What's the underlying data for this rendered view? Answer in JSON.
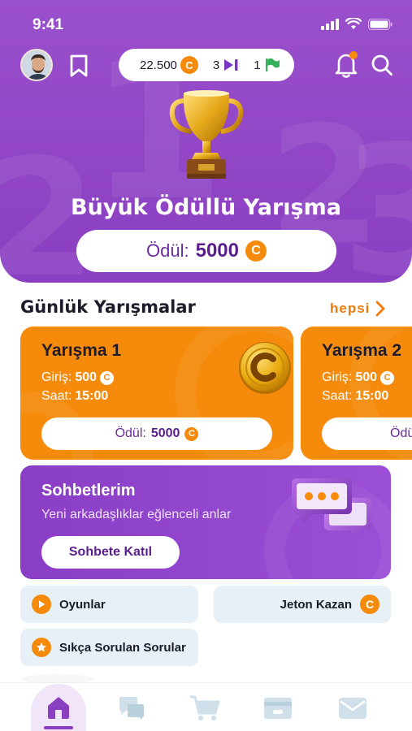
{
  "status_bar": {
    "time": "9:41"
  },
  "top_bar": {
    "coins": "22.500",
    "coin_symbol": "C",
    "tickets": "3",
    "flags": "1"
  },
  "hero": {
    "title": "Büyük Ödüllü Yarışma",
    "prize_label": "Ödül:",
    "prize_value": "5000",
    "coin_symbol": "C"
  },
  "daily": {
    "section_title": "Günlük Yarışmalar",
    "see_all": "hepsi",
    "cards": [
      {
        "title": "Yarışma 1",
        "entry_label": "Giriş:",
        "entry_value": "500",
        "time_label": "Saat:",
        "time_value": "15:00",
        "prize_label": "Ödül:",
        "prize_value": "5000",
        "coin_symbol": "C"
      },
      {
        "title": "Yarışma 2",
        "entry_label": "Giriş:",
        "entry_value": "500",
        "time_label": "Saat:",
        "time_value": "15:00",
        "prize_label": "Ödü",
        "prize_value": "",
        "coin_symbol": "C"
      }
    ]
  },
  "chat": {
    "title": "Sohbetlerim",
    "subtitle": "Yeni arkadaşlıklar eğlenceli anlar",
    "button": "Sohbete Katıl"
  },
  "tiles": {
    "games": "Oyunlar",
    "earn_coins": "Jeton Kazan",
    "faq": "Sıkça Sorulan Sorular",
    "coin_symbol": "C"
  },
  "bottom_nav": {
    "items": [
      "home-icon",
      "chat-icon",
      "cart-icon",
      "wallet-icon",
      "mail-icon"
    ],
    "active": "home-icon"
  },
  "colors": {
    "purple": "#8a3fc1",
    "orange": "#f58a0b",
    "tile": "#e6f0f6"
  }
}
